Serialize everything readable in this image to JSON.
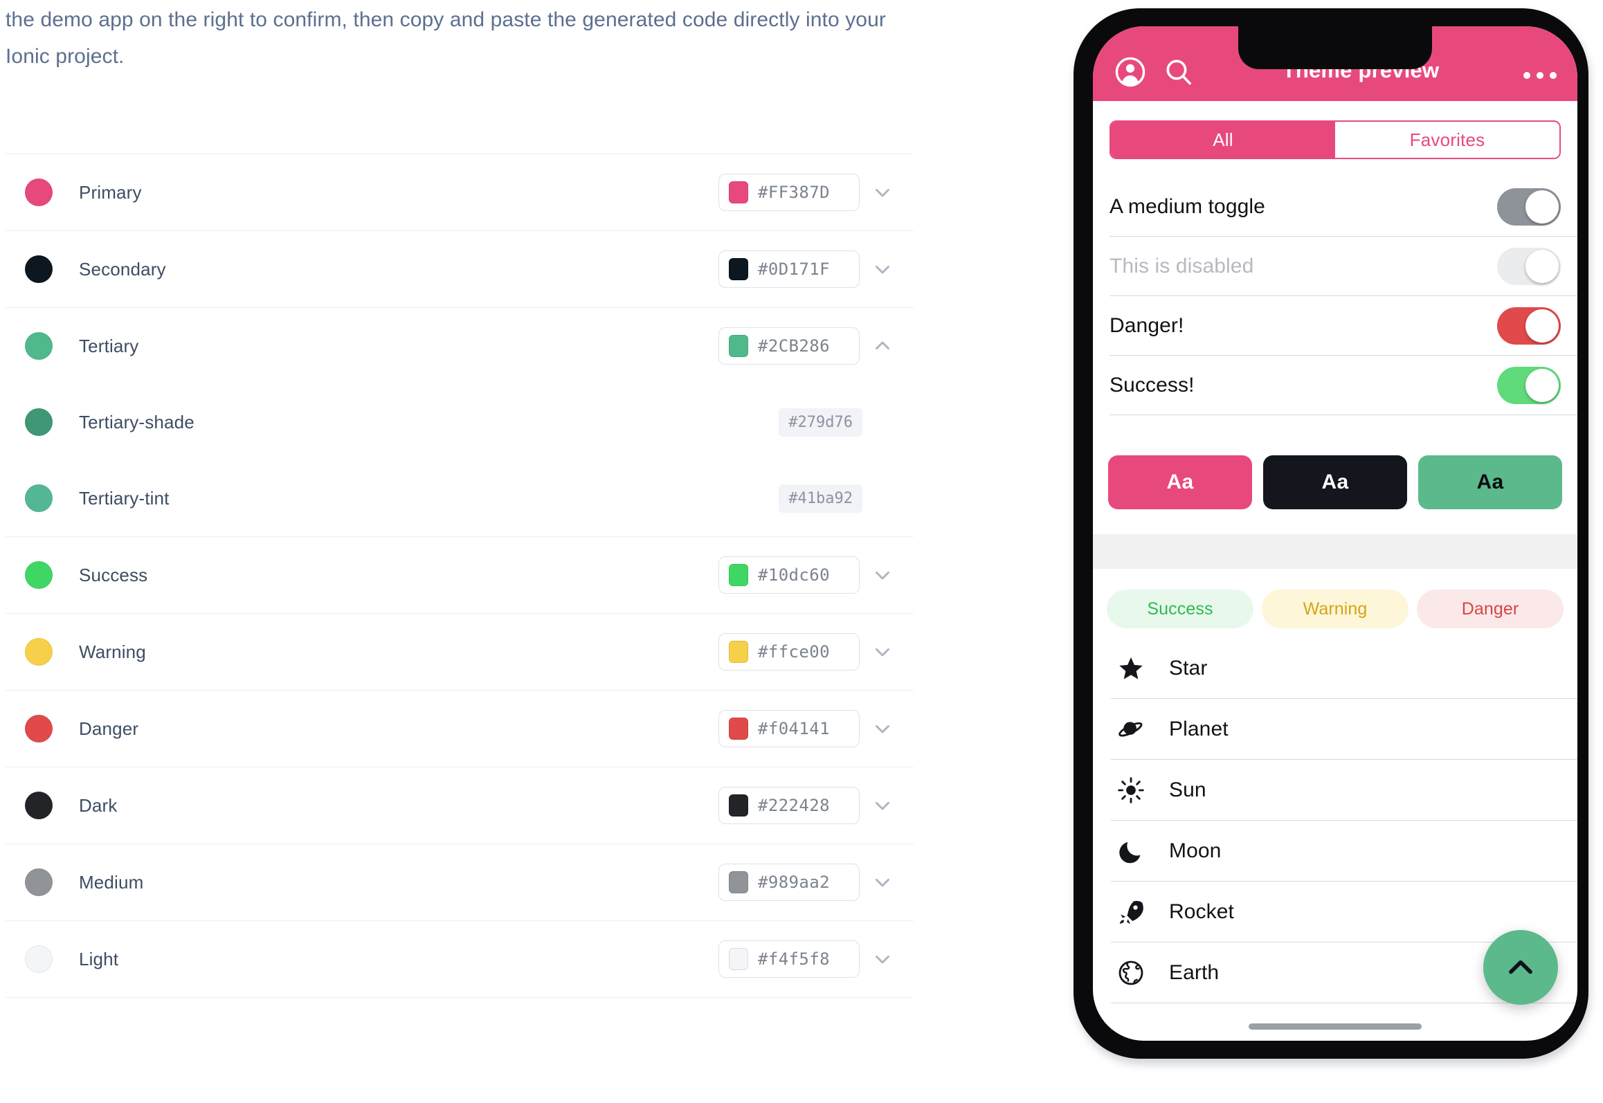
{
  "intro": {
    "paragraph": "the demo app on the right to confirm, then copy and paste the generated code directly into your Ionic project."
  },
  "color_list": {
    "rows": [
      {
        "name": "Primary",
        "label": "Primary",
        "hex": "#FF387D",
        "dot": "#e8497d",
        "swatch": "#e8497d",
        "expandable": true,
        "expanded": false,
        "sub": false,
        "chevron": "chevron-down-icon"
      },
      {
        "name": "Secondary",
        "label": "Secondary",
        "hex": "#0D171F",
        "dot": "#0d171f",
        "swatch": "#0d171f",
        "expandable": true,
        "expanded": false,
        "sub": false,
        "chevron": "chevron-down-icon"
      },
      {
        "name": "Tertiary",
        "label": "Tertiary",
        "hex": "#2CB286",
        "dot": "#4fb98c",
        "swatch": "#4fb98c",
        "expandable": true,
        "expanded": true,
        "sub": false,
        "chevron": "chevron-up-icon"
      },
      {
        "name": "Tertiary-shade",
        "label": "Tertiary-shade",
        "hex": "#279d76",
        "dot": "#3f9776",
        "swatch": "#3f9776",
        "expandable": false,
        "expanded": false,
        "sub": true,
        "chevron": ""
      },
      {
        "name": "Tertiary-tint",
        "label": "Tertiary-tint",
        "hex": "#41ba92",
        "dot": "#53b795",
        "swatch": "#53b795",
        "expandable": false,
        "expanded": false,
        "sub": true,
        "chevron": ""
      },
      {
        "name": "Success",
        "label": "Success",
        "hex": "#10dc60",
        "dot": "#3fd763",
        "swatch": "#3fd763",
        "expandable": true,
        "expanded": false,
        "sub": false,
        "chevron": "chevron-down-icon"
      },
      {
        "name": "Warning",
        "label": "Warning",
        "hex": "#ffce00",
        "dot": "#f7d04a",
        "swatch": "#f7d04a",
        "expandable": true,
        "expanded": false,
        "sub": false,
        "chevron": "chevron-down-icon"
      },
      {
        "name": "Danger",
        "label": "Danger",
        "hex": "#f04141",
        "dot": "#e04a4a",
        "swatch": "#e04a4a",
        "expandable": true,
        "expanded": false,
        "sub": false,
        "chevron": "chevron-down-icon"
      },
      {
        "name": "Dark",
        "label": "Dark",
        "hex": "#222428",
        "dot": "#222428",
        "swatch": "#222428",
        "expandable": true,
        "expanded": false,
        "sub": false,
        "chevron": "chevron-down-icon"
      },
      {
        "name": "Medium",
        "label": "Medium",
        "hex": "#989aa2",
        "dot": "#909499",
        "swatch": "#909499",
        "expandable": true,
        "expanded": false,
        "sub": false,
        "chevron": "chevron-down-icon"
      },
      {
        "name": "Light",
        "label": "Light",
        "hex": "#f4f5f8",
        "dot": "#f4f5f8",
        "swatch": "#f4f5f8",
        "expandable": true,
        "expanded": false,
        "sub": false,
        "chevron": "chevron-down-icon"
      }
    ]
  },
  "phone": {
    "header": {
      "title": "Theme preview",
      "background": "#e8497d",
      "avatar_icon": "person-icon",
      "search_icon": "search-icon",
      "menu_icon": "ellipsis-icon"
    },
    "segment": {
      "options": [
        {
          "label": "All",
          "selected": true
        },
        {
          "label": "Favorites",
          "selected": false
        }
      ],
      "accent": "#e8497d"
    },
    "toggles": [
      {
        "label": "A medium toggle",
        "on": true,
        "color": "#8e9299",
        "disabled": false
      },
      {
        "label": "This is disabled",
        "on": true,
        "color": "#ebecee",
        "disabled": true
      },
      {
        "label": "Danger!",
        "on": true,
        "color": "#e04a4a",
        "disabled": false
      },
      {
        "label": "Success!",
        "on": true,
        "color": "#5fdb7b",
        "disabled": false
      }
    ],
    "buttons": [
      {
        "label": "Aa",
        "bg": "#e8497d",
        "fg": "#ffffff"
      },
      {
        "label": "Aa",
        "bg": "#13161c",
        "fg": "#ffffff"
      },
      {
        "label": "Aa",
        "bg": "#5bb98c",
        "fg": "#0b0c0f"
      }
    ],
    "chips": [
      {
        "label": "Success",
        "bg": "#e8f8ec",
        "fg": "#2fba52"
      },
      {
        "label": "Warning",
        "bg": "#fdf6d8",
        "fg": "#d3a617"
      },
      {
        "label": "Danger",
        "bg": "#fbe9e9",
        "fg": "#d94545"
      }
    ],
    "icon_list": [
      {
        "label": "Star",
        "icon": "star-icon"
      },
      {
        "label": "Planet",
        "icon": "planet-icon"
      },
      {
        "label": "Sun",
        "icon": "sun-icon"
      },
      {
        "label": "Moon",
        "icon": "moon-icon"
      },
      {
        "label": "Rocket",
        "icon": "rocket-icon"
      },
      {
        "label": "Earth",
        "icon": "earth-icon"
      }
    ],
    "fab": {
      "icon": "chevron-up-icon",
      "color": "#5bb98c"
    }
  }
}
